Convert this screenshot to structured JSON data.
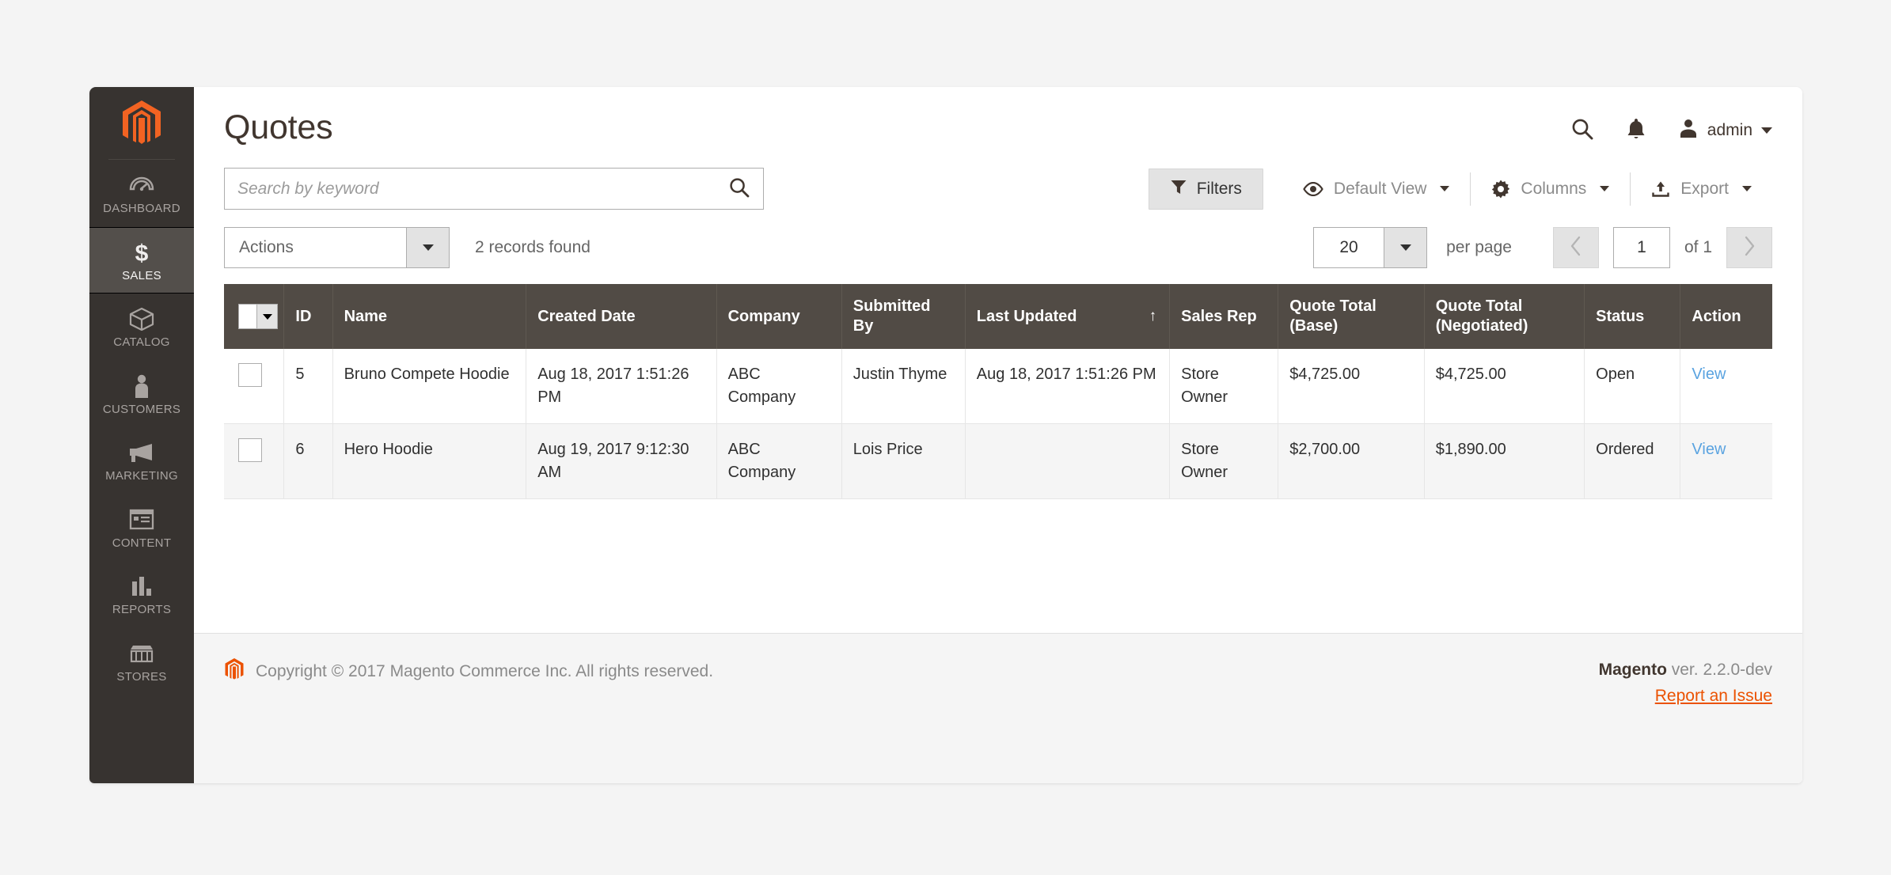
{
  "sidebar": {
    "logo_icon": "magento-logo-icon",
    "items": [
      {
        "label": "DASHBOARD",
        "icon": "dashboard-icon",
        "active": false
      },
      {
        "label": "SALES",
        "icon": "dollar-icon",
        "active": true
      },
      {
        "label": "CATALOG",
        "icon": "box-icon",
        "active": false
      },
      {
        "label": "CUSTOMERS",
        "icon": "person-icon",
        "active": false
      },
      {
        "label": "MARKETING",
        "icon": "megaphone-icon",
        "active": false
      },
      {
        "label": "CONTENT",
        "icon": "page-layout-icon",
        "active": false
      },
      {
        "label": "REPORTS",
        "icon": "bar-chart-icon",
        "active": false
      },
      {
        "label": "STORES",
        "icon": "storefront-icon",
        "active": false
      }
    ]
  },
  "header": {
    "title": "Quotes",
    "search_icon": "search-icon",
    "notifications_icon": "bell-icon",
    "user_icon": "user-avatar-icon",
    "user_name": "admin",
    "user_caret_icon": "chevron-down-icon"
  },
  "search": {
    "placeholder": "Search by keyword",
    "value": "",
    "submit_icon": "search-icon"
  },
  "view_controls": {
    "filters_label": "Filters",
    "filters_icon": "funnel-icon",
    "default_view_label": "Default View",
    "default_view_icon": "eye-icon",
    "columns_label": "Columns",
    "columns_icon": "gear-icon",
    "export_label": "Export",
    "export_icon": "export-upload-icon"
  },
  "grid_toolbar": {
    "actions_label": "Actions",
    "records_found": "2 records found",
    "per_page_value": "20",
    "per_page_label": "per page",
    "prev_icon": "chevron-left-icon",
    "next_icon": "chevron-right-icon",
    "page_value": "1",
    "of_label": "of 1"
  },
  "table": {
    "select_all_icon": "select-all-checkbox-dropdown",
    "sort_indicator": "↑",
    "sorted_column": "Last Updated",
    "columns": [
      "ID",
      "Name",
      "Created Date",
      "Company",
      "Submitted By",
      "Last Updated",
      "Sales Rep",
      "Quote Total (Base)",
      "Quote Total (Negotiated)",
      "Status",
      "Action"
    ],
    "rows": [
      {
        "id": "5",
        "name": "Bruno Compete Hoodie",
        "created_date": "Aug 18, 2017 1:51:26 PM",
        "company": "ABC Company",
        "submitted_by": "Justin Thyme",
        "last_updated": "Aug 18, 2017 1:51:26 PM",
        "sales_rep": "Store Owner",
        "quote_total_base": "$4,725.00",
        "quote_total_negotiated": "$4,725.00",
        "status": "Open",
        "action": "View"
      },
      {
        "id": "6",
        "name": "Hero Hoodie",
        "created_date": "Aug 19, 2017 9:12:30 AM",
        "company": "ABC Company",
        "submitted_by": "Lois Price",
        "last_updated": "",
        "sales_rep": "Store Owner",
        "quote_total_base": "$2,700.00",
        "quote_total_negotiated": "$1,890.00",
        "status": "Ordered",
        "action": "View"
      }
    ]
  },
  "footer": {
    "logo_icon": "magento-logo-icon",
    "copyright": "Copyright © 2017 Magento Commerce Inc. All rights reserved.",
    "brand": "Magento",
    "version": " ver. 2.2.0-dev",
    "report_link": "Report an Issue"
  },
  "colors": {
    "brand_orange": "#eb5202",
    "sidebar_bg": "#373330",
    "table_header_bg": "#514b45",
    "link_blue": "#5aa3e0",
    "page_bg": "#f4f4f4"
  }
}
